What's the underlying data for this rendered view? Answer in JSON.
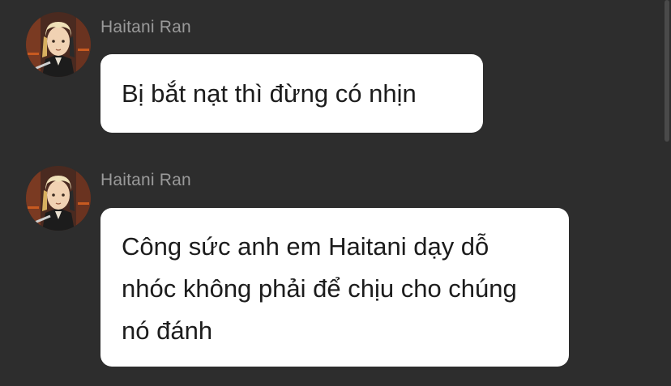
{
  "messages": [
    {
      "sender": "Haitani Ran",
      "text": "Bị bắt nạt thì đừng có nhịn"
    },
    {
      "sender": "Haitani Ran",
      "text": "Công sức anh em Haitani dạy dỗ nhóc không phải để chịu cho chúng nó đánh"
    }
  ],
  "colors": {
    "background": "#2d2d2d",
    "bubble": "#ffffff",
    "sender_name": "#9a9a9a",
    "message_text": "#1c1c1c"
  },
  "icons": {
    "avatar": "character-portrait-avatar"
  }
}
